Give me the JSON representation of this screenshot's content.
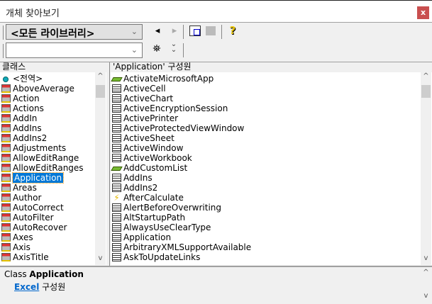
{
  "window": {
    "title": "개체 찾아보기",
    "close": "x"
  },
  "toolbar": {
    "library": "<모든 라이브러리>",
    "search_value": "",
    "back": "◂",
    "forward": "▸",
    "copy_icon": "copy-icon",
    "view_def_icon": "view-definition-icon",
    "help": "?",
    "search_icon": "binoculars-icon",
    "toggle": "⌄⌄"
  },
  "classes": {
    "header": "클래스",
    "items": [
      {
        "label": "<전역>",
        "icon": "globe"
      },
      {
        "label": "AboveAverage",
        "icon": "class"
      },
      {
        "label": "Action",
        "icon": "class"
      },
      {
        "label": "Actions",
        "icon": "class"
      },
      {
        "label": "AddIn",
        "icon": "class"
      },
      {
        "label": "AddIns",
        "icon": "class"
      },
      {
        "label": "AddIns2",
        "icon": "class"
      },
      {
        "label": "Adjustments",
        "icon": "class"
      },
      {
        "label": "AllowEditRange",
        "icon": "class"
      },
      {
        "label": "AllowEditRanges",
        "icon": "class"
      },
      {
        "label": "Application",
        "icon": "class",
        "selected": true
      },
      {
        "label": "Areas",
        "icon": "class"
      },
      {
        "label": "Author",
        "icon": "class"
      },
      {
        "label": "AutoCorrect",
        "icon": "class"
      },
      {
        "label": "AutoFilter",
        "icon": "class"
      },
      {
        "label": "AutoRecover",
        "icon": "class"
      },
      {
        "label": "Axes",
        "icon": "class"
      },
      {
        "label": "Axis",
        "icon": "class"
      },
      {
        "label": "AxisTitle",
        "icon": "class"
      }
    ]
  },
  "members": {
    "header": "'Application' 구성원",
    "items": [
      {
        "label": "ActivateMicrosoftApp",
        "icon": "method"
      },
      {
        "label": "ActiveCell",
        "icon": "property"
      },
      {
        "label": "ActiveChart",
        "icon": "property"
      },
      {
        "label": "ActiveEncryptionSession",
        "icon": "property"
      },
      {
        "label": "ActivePrinter",
        "icon": "property"
      },
      {
        "label": "ActiveProtectedViewWindow",
        "icon": "property"
      },
      {
        "label": "ActiveSheet",
        "icon": "property"
      },
      {
        "label": "ActiveWindow",
        "icon": "property"
      },
      {
        "label": "ActiveWorkbook",
        "icon": "property"
      },
      {
        "label": "AddCustomList",
        "icon": "method"
      },
      {
        "label": "AddIns",
        "icon": "property"
      },
      {
        "label": "AddIns2",
        "icon": "property"
      },
      {
        "label": "AfterCalculate",
        "icon": "event"
      },
      {
        "label": "AlertBeforeOverwriting",
        "icon": "property"
      },
      {
        "label": "AltStartupPath",
        "icon": "property"
      },
      {
        "label": "AlwaysUseClearType",
        "icon": "property"
      },
      {
        "label": "Application",
        "icon": "property"
      },
      {
        "label": "ArbitraryXMLSupportAvailable",
        "icon": "property"
      },
      {
        "label": "AskToUpdateLinks",
        "icon": "property"
      }
    ]
  },
  "details": {
    "kind": "Class",
    "name": "Application",
    "library_link": "Excel",
    "member_of": "구성원"
  }
}
